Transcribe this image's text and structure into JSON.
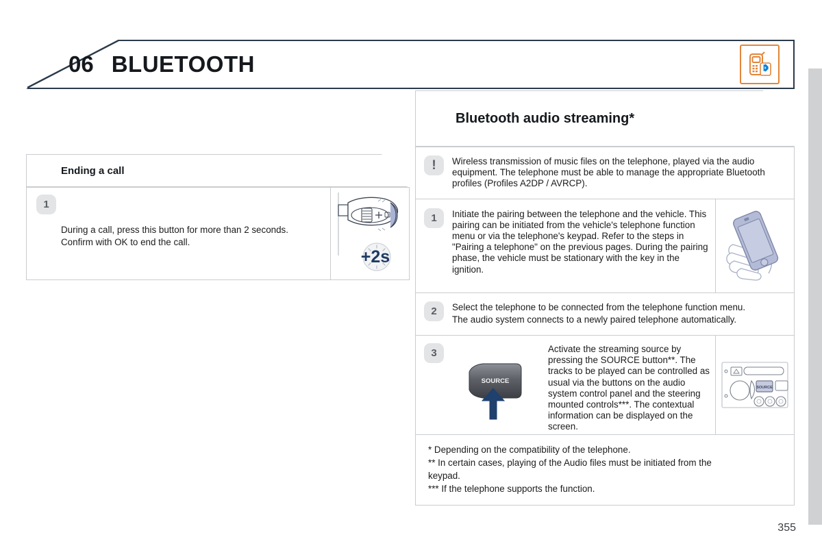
{
  "header": {
    "chapter_number": "06",
    "chapter_title": "BLUETOOTH",
    "icon_name": "phone-bluetooth-icon",
    "icon_color": "#e2863a"
  },
  "left_column": {
    "section_title": "Ending a call",
    "steps": [
      {
        "badge": "1",
        "lines": [
          "During a call, press this button for more than 2 seconds.",
          "Confirm with OK to end the call."
        ],
        "figure": "steering-column-stalk-plus-2s"
      }
    ]
  },
  "right_column": {
    "section_title": "Bluetooth audio streaming*",
    "warning": {
      "badge": "!",
      "text": "Wireless transmission of music files on the telephone, played via the audio equipment. The telephone must be able to manage the appropriate Bluetooth profiles (Profiles A2DP / AVRCP)."
    },
    "steps": [
      {
        "badge": "1",
        "lines": [
          "Initiate the pairing between the telephone and the vehicle. This pairing can be initiated from the vehicle's telephone function menu or via the telephone's keypad. Refer to the steps in \"Pairing a telephone\" on the previous pages. During the pairing phase, the vehicle must be stationary with the key in the ignition."
        ],
        "figure": "hand-holding-smartphone"
      },
      {
        "badge": "2",
        "lines": [
          "Select the telephone to be connected from the telephone function menu.",
          "The audio system connects to a newly paired telephone automatically."
        ],
        "figure": null
      },
      {
        "badge": "3",
        "lines": [
          "Activate the streaming source by pressing the SOURCE button**. The tracks to be played can be controlled as usual via the buttons on the audio system control panel and the steering mounted controls***. The contextual information can be displayed on the screen."
        ],
        "inline_figure": "source-button-with-arrow",
        "inline_figure_label": "SOURCE",
        "figure": "car-audio-head-unit"
      }
    ],
    "footnotes": [
      "* Depending on the compatibility of the telephone.",
      "** In certain cases, playing of the Audio files must be initiated from the",
      "keypad.",
      "*** If the telephone supports the function."
    ]
  },
  "footer": {
    "page_number": "355"
  },
  "figures": {
    "plus_2s_label": "+2s"
  }
}
